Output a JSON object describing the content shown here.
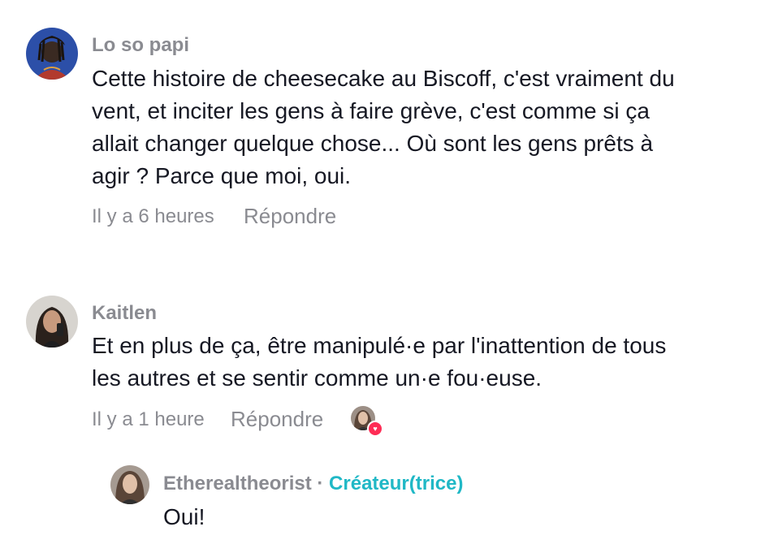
{
  "comments": [
    {
      "username": "Lo so papi",
      "lines": [
        "Cette histoire de cheesecake au Biscoff, c'est vraiment du",
        "vent, et inciter les gens à faire grève, c'est comme si ça",
        "allait changer quelque chose... Où sont les gens prêts à",
        "agir ? Parce que moi, oui."
      ],
      "time": "Il y a 6 heures",
      "reply_label": "Répondre"
    },
    {
      "username": "Kaitlen",
      "lines": [
        "Et en plus de ça, être manipulé·e par l'inattention de tous",
        "les autres et se sentir comme un·e fou·euse."
      ],
      "time": "Il y a 1 heure",
      "reply_label": "Répondre",
      "liked_by_creator": true
    }
  ],
  "reply": {
    "username": "Etherealtheorist",
    "separator": " · ",
    "badge": "Créateur(trice)",
    "text": "Oui!"
  },
  "colors": {
    "username": "#8a8b91",
    "text": "#161823",
    "creator_badge": "#20b8c6",
    "heart": "#fe2c55"
  }
}
